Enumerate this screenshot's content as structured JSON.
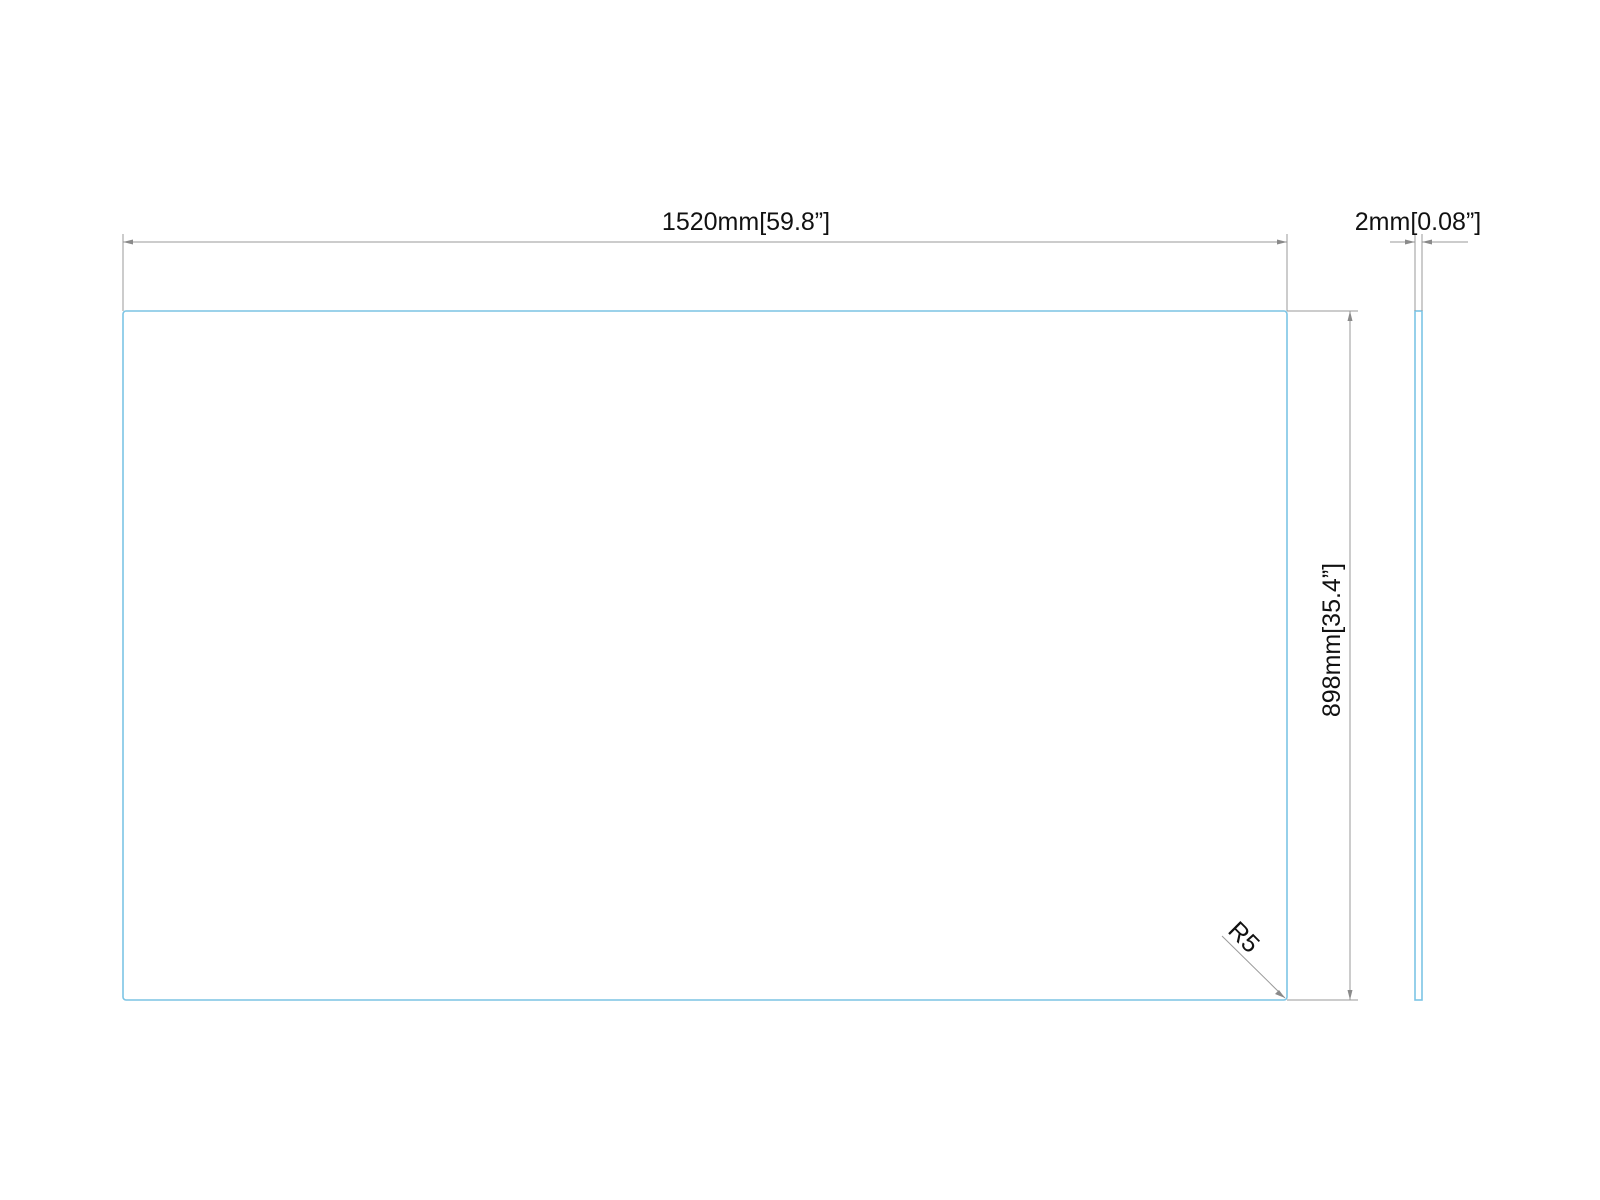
{
  "dimensions": {
    "width_label": "1520mm[59.8”]",
    "height_label": "898mm[35.4”]",
    "thickness_label": "2mm[0.08”]",
    "corner_radius_label": "R5"
  },
  "colors": {
    "outline": "#7cc4e4",
    "dimension_line": "#9a9a9a",
    "text": "#111111"
  }
}
